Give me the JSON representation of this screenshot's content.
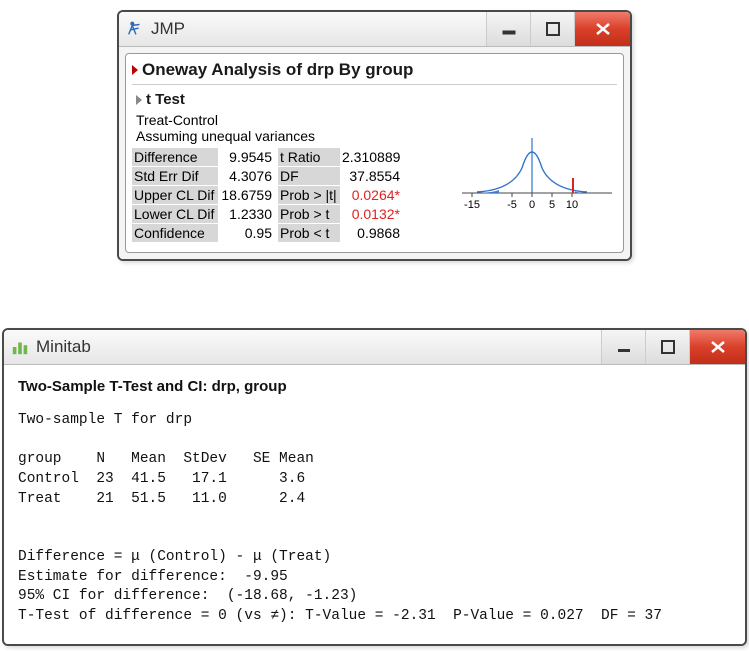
{
  "jmp": {
    "app_title": "JMP",
    "panel_title": "Oneway Analysis of drp By group",
    "section_title": "t Test",
    "comparison": "Treat-Control",
    "assumption": "Assuming unequal variances",
    "rows": {
      "r0": {
        "l1": "Difference",
        "v1": "9.9545",
        "l2": "t Ratio",
        "v2": "2.310889"
      },
      "r1": {
        "l1": "Std Err Dif",
        "v1": "4.3076",
        "l2": "DF",
        "v2": "37.8554"
      },
      "r2": {
        "l1": "Upper CL Dif",
        "v1": "18.6759",
        "l2": "Prob > |t|",
        "v2": "0.0264*"
      },
      "r3": {
        "l1": "Lower CL Dif",
        "v1": "1.2330",
        "l2": "Prob > t",
        "v2": "0.0132*"
      },
      "r4": {
        "l1": "Confidence",
        "v1": "0.95",
        "l2": "Prob < t",
        "v2": "0.9868"
      }
    },
    "plot_ticks": [
      "-15",
      "-5",
      "0",
      "5",
      "10"
    ]
  },
  "minitab": {
    "app_title": "Minitab",
    "heading": "Two-Sample T-Test and CI: drp, group",
    "line1": "Two-sample T for drp",
    "columns": "group    N   Mean  StDev   SE Mean",
    "row_c": "Control  23  41.5   17.1      3.6",
    "row_t": "Treat    21  51.5   11.0      2.4",
    "diff_def": "Difference = μ (Control) - μ (Treat)",
    "estim": "Estimate for difference:  -9.95",
    "ci": "95% CI for difference:  (-18.68, -1.23)",
    "ttest": "T-Test of difference = 0 (vs ≠): T-Value = -2.31  P-Value = 0.027  DF = 37"
  }
}
